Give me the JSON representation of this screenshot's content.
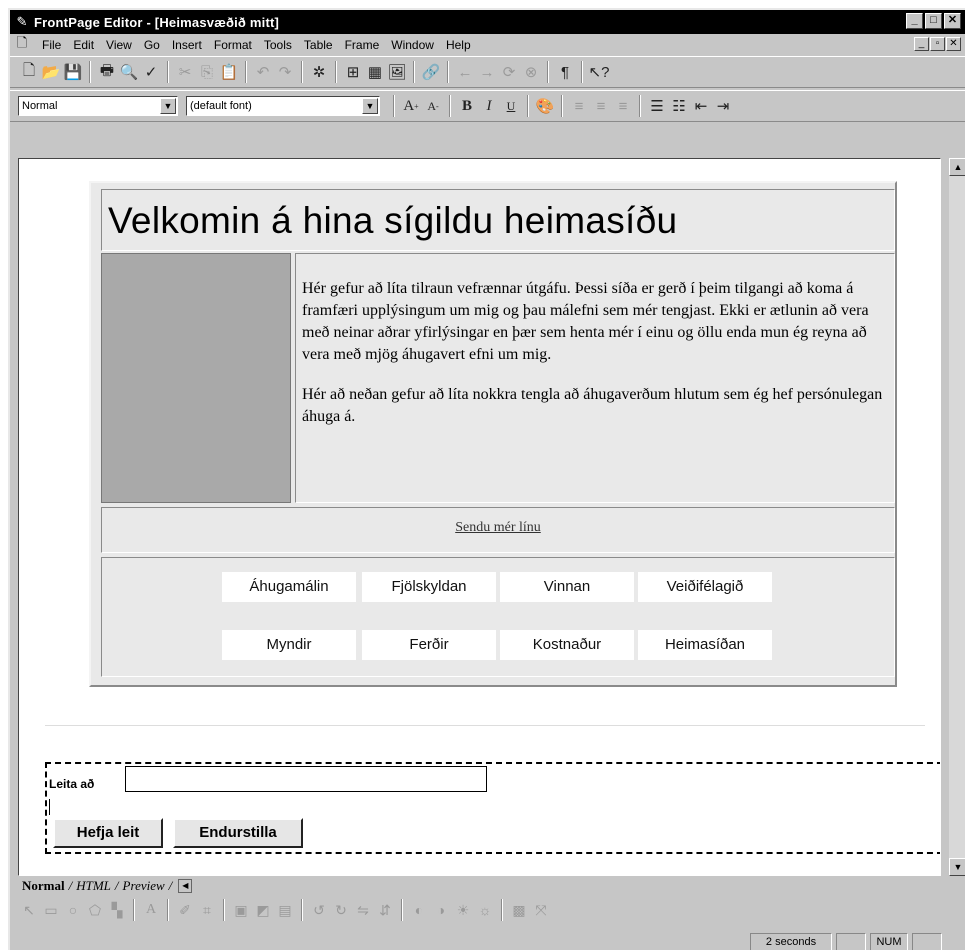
{
  "window": {
    "title": "FrontPage Editor - [Heimasvæðið mitt]",
    "buttons": [
      "_",
      "□",
      "✕"
    ]
  },
  "menubar": {
    "items": [
      "File",
      "Edit",
      "View",
      "Go",
      "Insert",
      "Format",
      "Tools",
      "Table",
      "Frame",
      "Window",
      "Help"
    ],
    "mdi_buttons": [
      "_",
      "▫",
      "✕"
    ]
  },
  "format_toolbar": {
    "style_value": "Normal",
    "font_value": "(default font)"
  },
  "page": {
    "heading": "Velkomin á hina sígildu heimasíðu",
    "paragraphs": [
      "Hér gefur að líta tilraun vefrænnar útgáfu. Þessi síða er gerð í þeim tilgangi að koma á framfæri upplýsingum um mig og þau málefni sem mér tengjast. Ekki er ætlunin að vera með neinar aðrar yfirlýsingar en þær sem henta mér í einu og öllu enda mun ég reyna að vera með mjög áhugavert efni um mig.",
      "Hér að neðan gefur að líta nokkra tengla að áhugaverðum hlutum sem ég hef persónulegan áhuga á."
    ],
    "mail_link": "Sendu mér línu",
    "nav_row1": [
      "Áhugamálin",
      "Fjölskyldan",
      "Vinnan",
      "Veiðifélagið"
    ],
    "nav_row2": [
      "Myndir",
      "Ferðir",
      "Kostnaður",
      "Heimasíðan"
    ]
  },
  "search_form": {
    "label": "Leita að",
    "input_value": "",
    "submit_label": "Hefja leit",
    "reset_label": "Endurstilla"
  },
  "tabs": [
    "Normal",
    "HTML",
    "Preview"
  ],
  "status": {
    "time": "2 seconds",
    "num": "NUM"
  }
}
